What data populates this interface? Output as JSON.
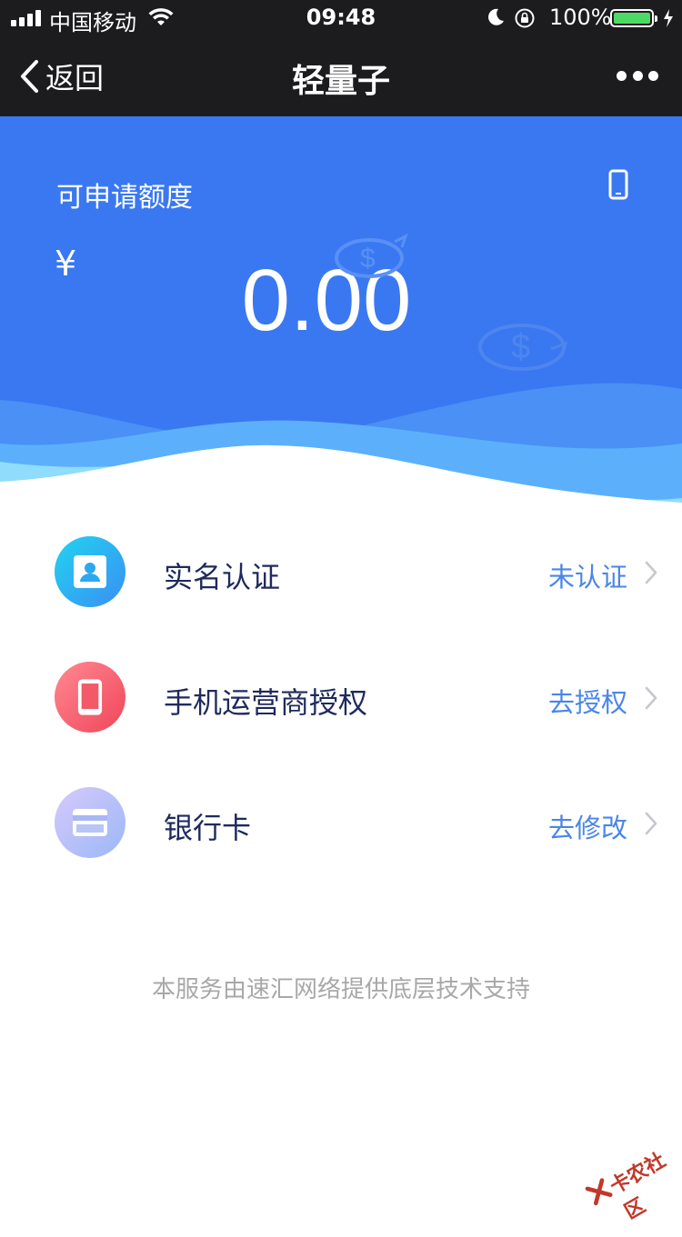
{
  "status_bar": {
    "carrier": "中国移动",
    "time": "09:48",
    "battery_percent": "100%"
  },
  "nav": {
    "back_label": "返回",
    "title": "轻量子"
  },
  "hero": {
    "label": "可申请额度",
    "currency": "¥",
    "amount": "0.00"
  },
  "items": [
    {
      "label": "实名认证",
      "status": "未认证",
      "icon": "id-card-icon"
    },
    {
      "label": "手机运营商授权",
      "status": "去授权",
      "icon": "mobile-phone-icon"
    },
    {
      "label": "银行卡",
      "status": "去修改",
      "icon": "bank-card-icon"
    }
  ],
  "footer": {
    "note": "本服务由速汇网络提供底层技术支持"
  },
  "watermark": {
    "text": "卡农社区"
  },
  "colors": {
    "hero_bg": "#3a78f2",
    "status_text": "#4a86e8",
    "label_text": "#1f2a5c",
    "footer_text": "#a8a8a8"
  }
}
